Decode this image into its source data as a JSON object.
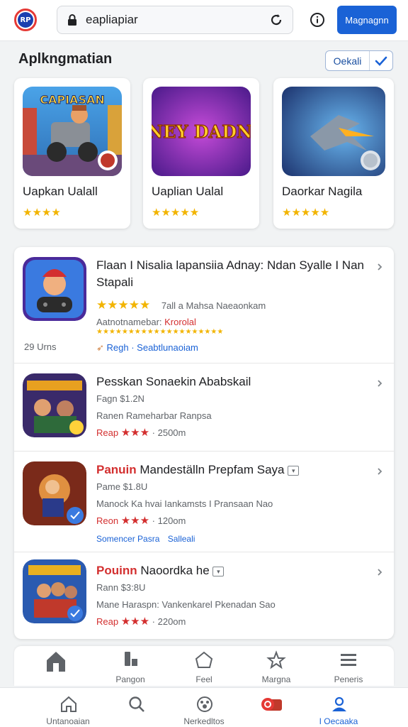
{
  "topbar": {
    "logo_text": "RP",
    "url": "eapliapiar",
    "action_button": "Magnagnn"
  },
  "section": {
    "title": "Aplkngmatian",
    "select_label": "Oekali"
  },
  "featured": [
    {
      "title": "Uapkan Ualall",
      "rating": 4,
      "icon": "game-art-truck",
      "art_text": "CAPIASAN"
    },
    {
      "title": "Uaplian Ualal",
      "rating": 5,
      "icon": "game-art-title",
      "art_text": "SENEY DADNAK"
    },
    {
      "title": "Daorkar Nagila",
      "rating": 5,
      "icon": "game-art-jet",
      "art_text": ""
    }
  ],
  "list": [
    {
      "title": "Flaan I Nisalia lapansiia Adnay: Ndan Syalle I Nan",
      "title2": "Stapali",
      "rating_text": "7all  a  Mahsa Naeaonkam",
      "line3_a": "Aatnotnamebar: ",
      "line3_b": "Krorolal",
      "small_stars": "★★★★★★★★★★★★★★★★★★★★",
      "left_note": "29 Urns",
      "link": "Regh · Seabtlunaoiam",
      "icon": "controller-character-icon"
    },
    {
      "title": "Pesskan Sonaekin Ababskail",
      "price": "Fagn $1.2N",
      "desc": "Ranen Rameharbar Ranpsa",
      "tag": "Reap",
      "meta": "· 2500m",
      "icon": "game-art-heroes"
    },
    {
      "title_a": "Panuin",
      "title_b": " Mandeställn Prepfam Saya",
      "price": "Pame $1.8U",
      "desc": "Manock Ka hvai Iankamsts I Pransaan Nao",
      "tag": "Reon",
      "meta": "· 120om",
      "link_a": "Somencer Pasra",
      "link_b": "Salleali",
      "icon": "game-art-hero-red"
    },
    {
      "title_a": "Pouinn",
      "title_b": " Naoordka he",
      "price": "Rann $3:8U",
      "desc": "Mane Haraspn: Vankenkarel Pkenadan Sao",
      "tag": "Reap",
      "meta": "· 220om",
      "icon": "game-art-squad"
    }
  ],
  "tabbar": [
    {
      "label": "",
      "icon": "home-filled-icon"
    },
    {
      "label": "Pangon",
      "icon": "battery-icon"
    },
    {
      "label": "Feel",
      "icon": "house-outline-icon"
    },
    {
      "label": "Margna",
      "icon": "star-outline-icon"
    },
    {
      "label": "Peneris",
      "icon": "menu-icon"
    }
  ],
  "bottomnav": [
    {
      "label": "Untanoaian",
      "icon": "home-icon"
    },
    {
      "label": "",
      "icon": "search-icon"
    },
    {
      "label": "Nerkedltos",
      "icon": "paw-icon"
    },
    {
      "label": "",
      "icon": "record-icon"
    },
    {
      "label": "I Oecaaka",
      "icon": "account-icon",
      "active": true
    }
  ],
  "colors": {
    "accent": "#1a62d6",
    "star_gold": "#f2b400",
    "price_red": "#d32f2f"
  }
}
